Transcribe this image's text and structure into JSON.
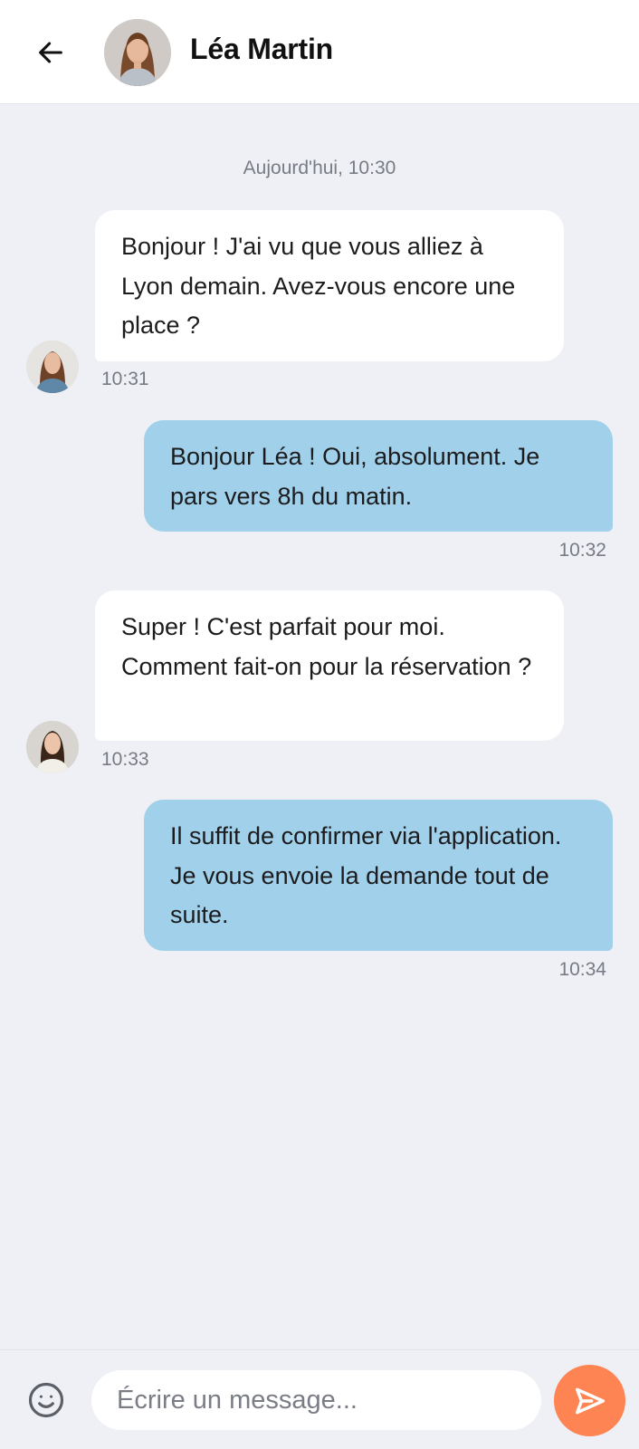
{
  "header": {
    "back_icon": "arrow-left-icon",
    "contact_name": "Léa Martin"
  },
  "conversation": {
    "date_separator": "Aujourd'hui, 10:30",
    "messages": [
      {
        "direction": "incoming",
        "text": "Bonjour ! J'ai vu que vous alliez à Lyon demain. Avez-vous encore une place ?",
        "time": "10:31"
      },
      {
        "direction": "outgoing",
        "text": "Bonjour Léa ! Oui, absolument. Je pars vers 8h du matin.",
        "time": "10:32"
      },
      {
        "direction": "incoming",
        "text": "Super ! C'est parfait pour moi. Comment fait-on pour la réservation ?",
        "time": "10:33"
      },
      {
        "direction": "outgoing",
        "text": "Il suffit de confirmer via l'application. Je vous envoie la demande tout de suite.",
        "time": "10:34"
      }
    ]
  },
  "composer": {
    "emoji_icon": "smiley-icon",
    "placeholder": "Écrire un message...",
    "value": "",
    "send_icon": "send-icon"
  },
  "colors": {
    "background": "#eff0f5",
    "incoming_bubble": "#ffffff",
    "outgoing_bubble": "#a1d0ea",
    "send_button": "#ff8454"
  }
}
